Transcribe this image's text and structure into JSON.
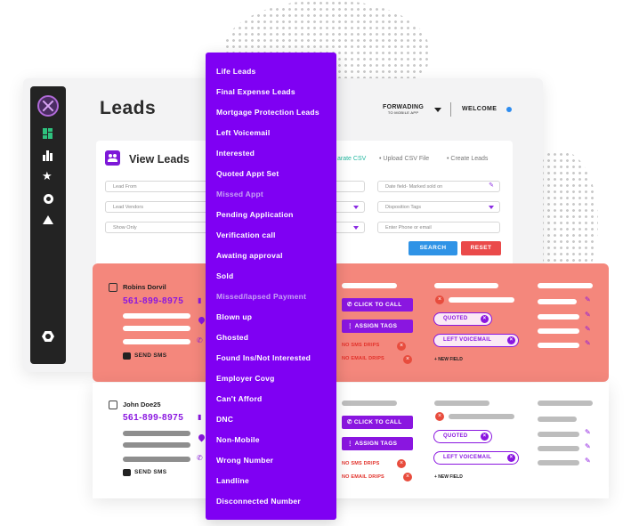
{
  "header": {
    "page_title": "Leads",
    "forwarding_line1": "FORWADING",
    "forwarding_line2": "TO MOBILE APP",
    "welcome": "WELCOME"
  },
  "view_leads": {
    "title": "View Leads",
    "link_separate_csv": "arate CSV",
    "link_upload": "• Upload CSV File",
    "link_create": "• Create Leads"
  },
  "filters": {
    "lead_from": "Lead From",
    "lead_vendors": "Lead Vendors",
    "show_only": "Show Only",
    "date_field": "Date field- Marked sold on",
    "disposition_tags": "Disposition Tags",
    "phone_email": "Enter Phone or email",
    "search_label": "SEARCH",
    "reset_label": "RESET"
  },
  "rows": [
    {
      "name": "Robins Dorvil",
      "phone": "561-899-8975",
      "send_sms": "SEND SMS",
      "click_to_call": "CLICK TO CALL",
      "assign_tags": "ASSIGN TAGS",
      "no_sms_drips": "NO SMS DRIPS",
      "no_email_drips": "NO EMAIL DRIPS",
      "tag1": "QUOTED",
      "tag2": "LEFT VOICEMAIL",
      "new_field": "+ NEW FIELD"
    },
    {
      "name": "John Doe25",
      "phone": "561-899-8975",
      "send_sms": "SEND SMS",
      "click_to_call": "CLICK TO CALL",
      "assign_tags": "ASSIGN TAGS",
      "no_sms_drips": "NO SMS DRIPS",
      "no_email_drips": "NO EMAIL DRIPS",
      "tag1": "QUOTED",
      "tag2": "LEFT VOICEMAIL",
      "new_field": "+ NEW FIELD"
    }
  ],
  "menu": {
    "items": [
      "Life Leads",
      "Final Expense Leads",
      "Mortgage Protection Leads",
      "Left Voicemail",
      "Interested",
      "Quoted Appt Set",
      "Missed Appt",
      "Pending Application",
      "Verification call",
      "Awating approval",
      "Sold",
      "Missed/lapsed Payment",
      "Blown up",
      "Ghosted",
      "Found Ins/Not Interested",
      "Employer Covg",
      "Can't Afford",
      "DNC",
      "Non-Mobile",
      "Wrong Number",
      "Landline",
      "Disconnected Number"
    ]
  },
  "colors": {
    "accent_purple": "#7f00f3",
    "highlight_row": "#f4877c",
    "search_blue": "#2f93e6",
    "reset_red": "#ea4a4a"
  },
  "icons": [
    "logo-icon",
    "dashboard-icon",
    "chart-icon",
    "star-icon",
    "circle-icon",
    "triangle-icon",
    "hexagon-icon",
    "users-icon",
    "chat-icon",
    "location-icon",
    "phone-icon",
    "pencil-icon",
    "close-icon",
    "caret-down-icon"
  ]
}
